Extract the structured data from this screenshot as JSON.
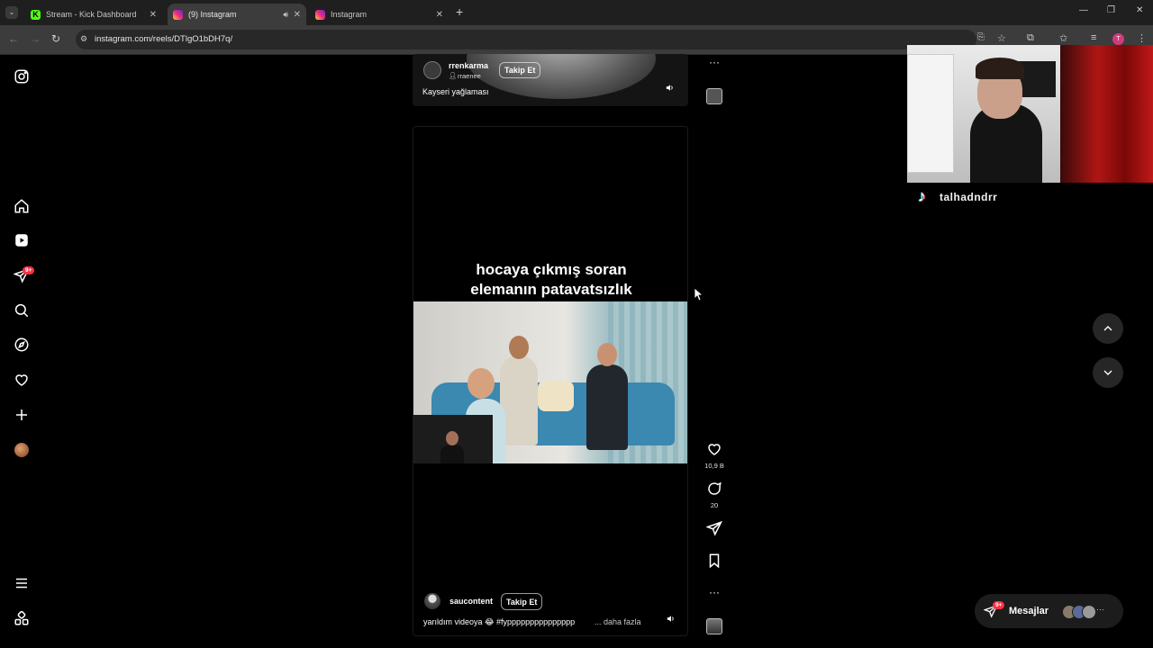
{
  "browser": {
    "tabs": [
      {
        "title": "Stream - Kick Dashboard",
        "favicon": "kick-icon",
        "active": false
      },
      {
        "title": "(9) Instagram",
        "favicon": "instagram-icon",
        "active": true,
        "audio": true
      },
      {
        "title": "Instagram",
        "favicon": "instagram-icon",
        "active": false
      }
    ],
    "new_tab": "+",
    "url": "instagram.com/reels/DTlgO1bDH7q/"
  },
  "nav": {
    "notifications_badge": "9+"
  },
  "reels": {
    "previous": {
      "username": "rrenkarma",
      "sub": "rraenee",
      "follow_label": "Takip Et",
      "caption": "Kayseri yağlaması"
    },
    "current": {
      "overlay_line1": "hocaya çıkmış soran",
      "overlay_line2": "elemanın patavatsızlık",
      "username": "saucontent",
      "follow_label": "Takip Et",
      "caption": "yarıldım videoya 😂 #fyppppppppppppppp",
      "more_label": "... daha fazla",
      "likes": "10,9 B",
      "comments": "20"
    },
    "more_dots": "···"
  },
  "overlay_streamer": {
    "tiktok_handle": "talhadndrr"
  },
  "messages": {
    "label": "Mesajlar",
    "badge": "9+"
  },
  "colors": {
    "accent_badge": "#ff3040",
    "kick_green": "#53fc18"
  }
}
